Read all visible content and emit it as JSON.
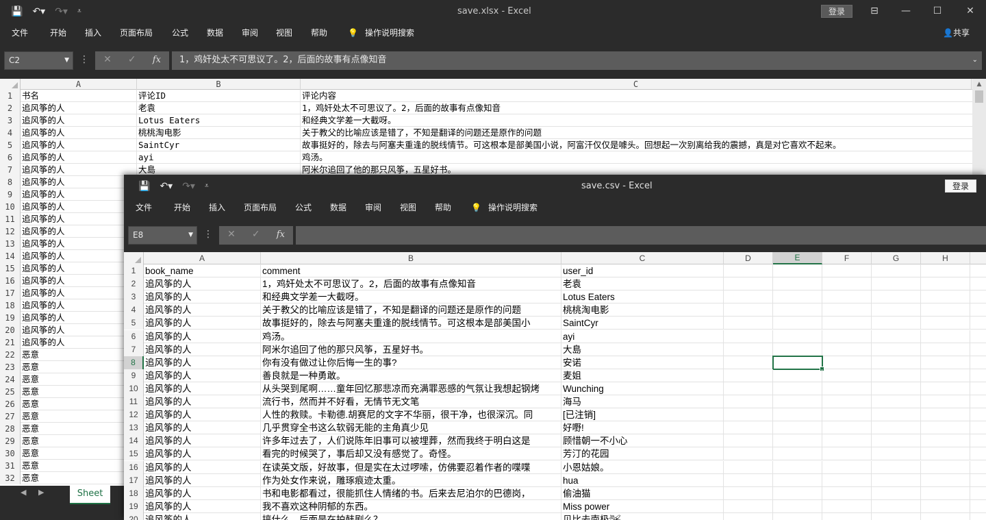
{
  "back_window": {
    "title": "save.xlsx  -  Excel",
    "login_label": "登录",
    "menu": [
      "文件",
      "开始",
      "插入",
      "页面布局",
      "公式",
      "数据",
      "审阅",
      "视图",
      "帮助",
      "操作说明搜索"
    ],
    "share_label": "共享",
    "namebox": "C2",
    "formula": "1，鸡奸处太不可思议了。2，后面的故事有点像知音",
    "columns": [
      "A",
      "B",
      "C"
    ],
    "rows": [
      {
        "n": "1",
        "a": "书名",
        "b": "评论ID",
        "c": "评论内容"
      },
      {
        "n": "2",
        "a": "追风筝的人",
        "b": "老袁",
        "c": "1，鸡奸处太不可思议了。2，后面的故事有点像知音"
      },
      {
        "n": "3",
        "a": "追风筝的人",
        "b": "Lotus Eaters",
        "c": "和经典文学差一大截呀。"
      },
      {
        "n": "4",
        "a": "追风筝的人",
        "b": "桃桃淘电影",
        "c": "关于教父的比喻应该是错了，不知是翻译的问题还是原作的问题"
      },
      {
        "n": "5",
        "a": "追风筝的人",
        "b": "SaintCyr",
        "c": "故事挺好的，除去与阿塞夫重逢的脱线情节。可这根本是部美国小说，阿富汗仅仅是噱头。回想起一次别离给我的震撼，真是对它喜欢不起来。"
      },
      {
        "n": "6",
        "a": "追风筝的人",
        "b": "ayi",
        "c": "鸡汤。"
      },
      {
        "n": "7",
        "a": "追风筝的人",
        "b": "大島",
        "c": "阿米尔追回了他的那只风筝，五星好书。"
      },
      {
        "n": "8",
        "a": "追风筝的人",
        "b": "",
        "c": ""
      },
      {
        "n": "9",
        "a": "追风筝的人",
        "b": "",
        "c": ""
      },
      {
        "n": "10",
        "a": "追风筝的人",
        "b": "",
        "c": ""
      },
      {
        "n": "11",
        "a": "追风筝的人",
        "b": "",
        "c": ""
      },
      {
        "n": "12",
        "a": "追风筝的人",
        "b": "",
        "c": ""
      },
      {
        "n": "13",
        "a": "追风筝的人",
        "b": "",
        "c": ""
      },
      {
        "n": "14",
        "a": "追风筝的人",
        "b": "",
        "c": ""
      },
      {
        "n": "15",
        "a": "追风筝的人",
        "b": "",
        "c": ""
      },
      {
        "n": "16",
        "a": "追风筝的人",
        "b": "",
        "c": ""
      },
      {
        "n": "17",
        "a": "追风筝的人",
        "b": "",
        "c": ""
      },
      {
        "n": "18",
        "a": "追风筝的人",
        "b": "",
        "c": ""
      },
      {
        "n": "19",
        "a": "追风筝的人",
        "b": "",
        "c": ""
      },
      {
        "n": "20",
        "a": "追风筝的人",
        "b": "",
        "c": ""
      },
      {
        "n": "21",
        "a": "追风筝的人",
        "b": "",
        "c": ""
      },
      {
        "n": "22",
        "a": "恶意",
        "b": "",
        "c": ""
      },
      {
        "n": "23",
        "a": "恶意",
        "b": "",
        "c": ""
      },
      {
        "n": "24",
        "a": "恶意",
        "b": "",
        "c": ""
      },
      {
        "n": "25",
        "a": "恶意",
        "b": "",
        "c": ""
      },
      {
        "n": "26",
        "a": "恶意",
        "b": "",
        "c": ""
      },
      {
        "n": "27",
        "a": "恶意",
        "b": "",
        "c": ""
      },
      {
        "n": "28",
        "a": "恶意",
        "b": "",
        "c": ""
      },
      {
        "n": "29",
        "a": "恶意",
        "b": "",
        "c": ""
      },
      {
        "n": "30",
        "a": "恶意",
        "b": "",
        "c": ""
      },
      {
        "n": "31",
        "a": "恶意",
        "b": "",
        "c": ""
      },
      {
        "n": "32",
        "a": "恶意",
        "b": "",
        "c": ""
      }
    ],
    "sheet_tab": "Sheet"
  },
  "front_window": {
    "title": "save.csv  -  Excel",
    "login_label": "登录",
    "menu": [
      "文件",
      "开始",
      "插入",
      "页面布局",
      "公式",
      "数据",
      "审阅",
      "视图",
      "帮助",
      "操作说明搜索"
    ],
    "namebox": "E8",
    "formula": "",
    "columns": [
      "A",
      "B",
      "C",
      "D",
      "E",
      "F",
      "G",
      "H"
    ],
    "selected_column": "E",
    "selected_row": "8",
    "rows": [
      {
        "n": "1",
        "a": "book_name",
        "b": "comment",
        "c": "user_id"
      },
      {
        "n": "2",
        "a": "追风筝的人",
        "b": "1，鸡奸处太不可思议了。2，后面的故事有点像知音",
        "c": "老袁"
      },
      {
        "n": "3",
        "a": "追风筝的人",
        "b": "和经典文学差一大截呀。",
        "c": "Lotus Eaters"
      },
      {
        "n": "4",
        "a": "追风筝的人",
        "b": "关于教父的比喻应该是错了，不知是翻译的问题还是原作的问题",
        "c": "桃桃淘电影"
      },
      {
        "n": "5",
        "a": "追风筝的人",
        "b": "故事挺好的，除去与阿塞夫重逢的脱线情节。可这根本是部美国小",
        "c": "SaintCyr"
      },
      {
        "n": "6",
        "a": "追风筝的人",
        "b": "鸡汤。",
        "c": "ayi"
      },
      {
        "n": "7",
        "a": "追风筝的人",
        "b": "阿米尔追回了他的那只风筝，五星好书。",
        "c": "大島"
      },
      {
        "n": "8",
        "a": "追风筝的人",
        "b": "你有没有做过让你后悔一生的事?",
        "c": "安诺"
      },
      {
        "n": "9",
        "a": "追风筝的人",
        "b": "善良就是一种勇敢。",
        "c": "麦姐"
      },
      {
        "n": "10",
        "a": "追风筝的人",
        "b": "从头哭到尾啊……童年回忆那悲凉而充满罪恶感的气氛让我想起钢烤",
        "c": "Wunching"
      },
      {
        "n": "11",
        "a": "追风筝的人",
        "b": "流行书，然而并不好看，无情节无文笔",
        "c": "海马"
      },
      {
        "n": "12",
        "a": "追风筝的人",
        "b": "人性的救赎。卡勒德.胡赛尼的文字不华丽，很干净，也很深沉。同",
        "c": "[已注销]"
      },
      {
        "n": "13",
        "a": "追风筝的人",
        "b": "几乎贯穿全书这么软弱无能的主角真少见",
        "c": "好嘢!"
      },
      {
        "n": "14",
        "a": "追风筝的人",
        "b": "许多年过去了，人们说陈年旧事可以被埋葬，然而我终于明白这是",
        "c": "顾惜朝一不小心"
      },
      {
        "n": "15",
        "a": "追风筝的人",
        "b": "看完的时候哭了，事后却又没有感觉了。奇怪。",
        "c": "芳汀的花园"
      },
      {
        "n": "16",
        "a": "追风筝的人",
        "b": "在读英文版，好故事，但是实在太过啰嗦，仿佛要忍着作者的喋喋",
        "c": "小恩姑娘。"
      },
      {
        "n": "17",
        "a": "追风筝的人",
        "b": "作为处女作来说，雕琢痕迹太重。",
        "c": "hua"
      },
      {
        "n": "18",
        "a": "追风筝的人",
        "b": "书和电影都看过，很能抓住人情绪的书。后来去尼泊尔的巴德岗，",
        "c": "偷油猫"
      },
      {
        "n": "19",
        "a": "追风筝的人",
        "b": "我不喜欢这种阴郁的东西。",
        "c": "Miss power"
      },
      {
        "n": "20",
        "a": "追风筝的人",
        "b": "搞什么，后面是在拍韩剧么？",
        "c": "贝比去南极🛩"
      }
    ]
  }
}
